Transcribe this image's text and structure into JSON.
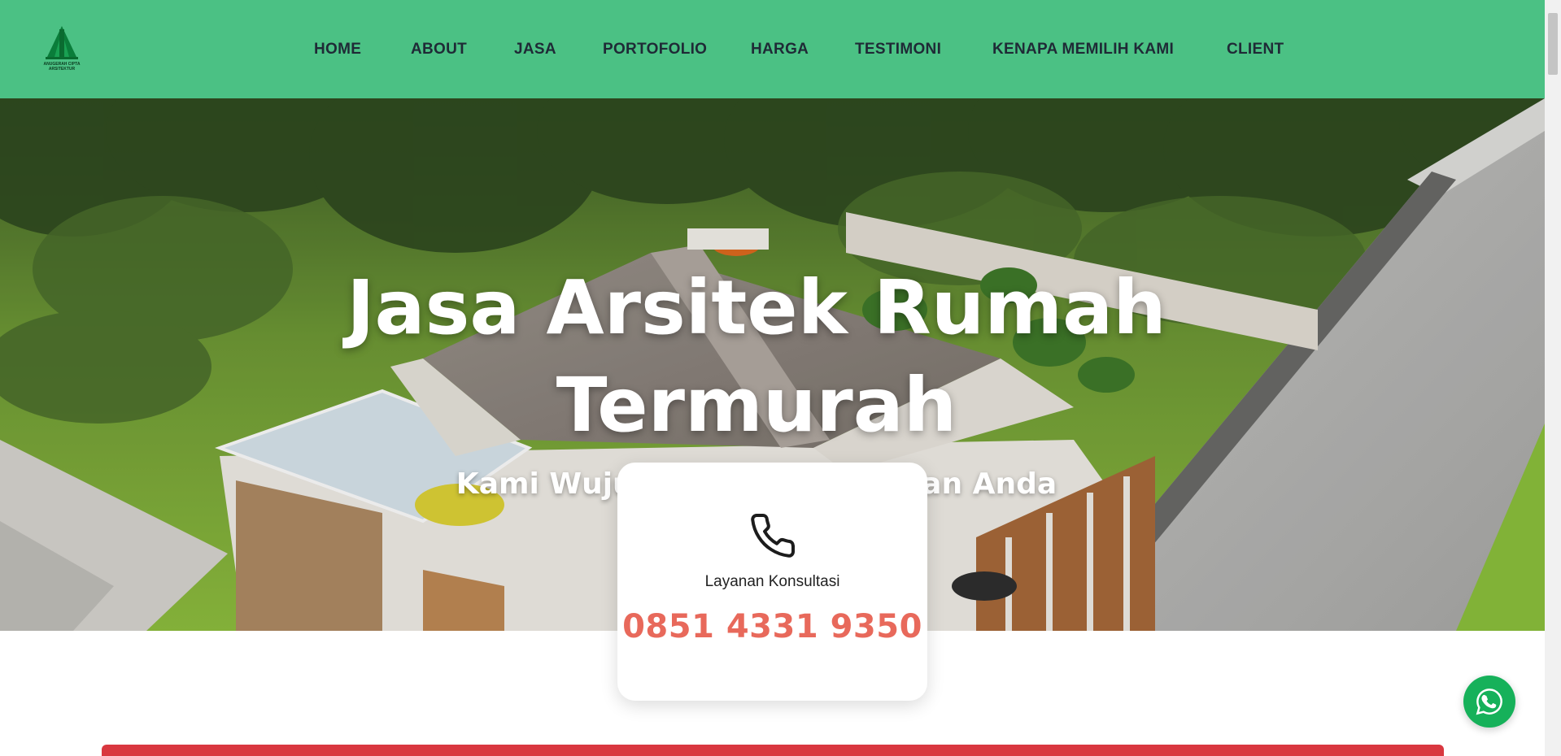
{
  "logo": {
    "icon": "tree-building-logo",
    "text_line1": "ANUGERAH CIPTA",
    "text_line2": "ARSITEKTUR"
  },
  "nav": {
    "items": [
      {
        "label": "HOME"
      },
      {
        "label": "ABOUT"
      },
      {
        "label": "JASA"
      },
      {
        "label": "PORTOFOLIO"
      },
      {
        "label": "HARGA"
      },
      {
        "label": "TESTIMONI"
      },
      {
        "label": "KENAPA MEMILIH KAMI"
      },
      {
        "label": "CLIENT"
      }
    ]
  },
  "hero": {
    "title_line1": "Jasa Arsitek Rumah",
    "title_line2": "Termurah",
    "subtitle": "Kami Wujudkan Rumah Impian Anda"
  },
  "consult": {
    "icon": "phone-icon",
    "label": "Layanan Konsultasi",
    "phone": "0851 4331 9350"
  },
  "whatsapp": {
    "icon": "whatsapp-icon"
  },
  "colors": {
    "header_bg": "#4bc184",
    "nav_text": "#1f2a36",
    "phone_accent": "#e8695b",
    "whatsapp": "#16b15a",
    "banner_red": "#d9373f"
  }
}
